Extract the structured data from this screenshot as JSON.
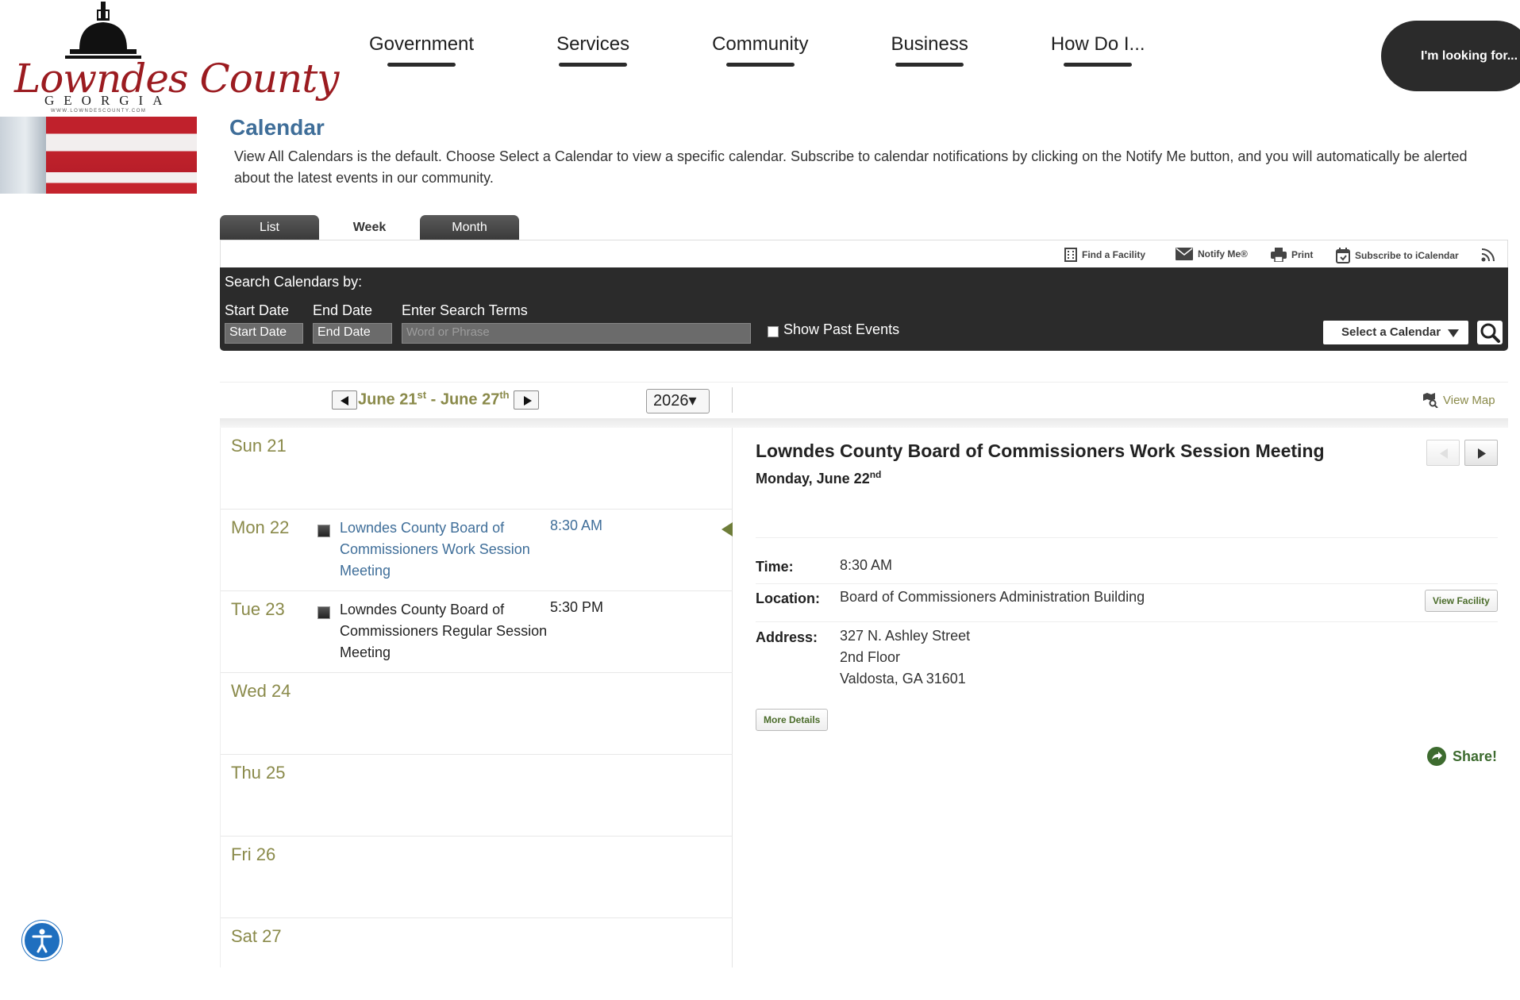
{
  "logo": {
    "script": "Lowndes County",
    "state": "GEORGIA",
    "url": "WWW.LOWNDESCOUNTY.COM"
  },
  "nav": [
    "Government",
    "Services",
    "Community",
    "Business",
    "How Do I..."
  ],
  "looking_for": "I'm looking for...",
  "page": {
    "title": "Calendar",
    "intro": "View All Calendars is the default. Choose Select a Calendar to view a specific calendar. Subscribe to calendar notifications by clicking on the Notify Me button, and you will automatically be alerted about the latest events in our community."
  },
  "tabs": [
    "List",
    "Week",
    "Month"
  ],
  "toolbar": {
    "find_facility": "Find a Facility",
    "notify": "Notify Me®",
    "print": "Print",
    "subscribe": "Subscribe to iCalendar"
  },
  "search": {
    "heading": "Search Calendars by:",
    "start_label": "Start Date",
    "end_label": "End Date",
    "terms_label": "Enter Search Terms",
    "start_value": "Start Date",
    "end_value": "End Date",
    "terms_placeholder": "Word or Phrase",
    "past_events": "Show Past Events",
    "select_calendar": "Select a Calendar"
  },
  "week": {
    "start": "June 21",
    "start_sup": "st",
    "sep": " - ",
    "end": "June 27",
    "end_sup": "th",
    "year": "2026",
    "view_map": "View Map"
  },
  "days": [
    {
      "name": "Sun 21"
    },
    {
      "name": "Mon 22",
      "event": "Lowndes County Board of Commissioners Work Session Meeting",
      "time": "8:30 AM"
    },
    {
      "name": "Tue 23",
      "event": "Lowndes County Board of Commissioners Regular Session Meeting",
      "time": "5:30 PM"
    },
    {
      "name": "Wed 24"
    },
    {
      "name": "Thu 25"
    },
    {
      "name": "Fri 26"
    },
    {
      "name": "Sat 27"
    }
  ],
  "detail": {
    "title": "Lowndes County Board of Commissioners Work Session Meeting",
    "date": "Monday, June 22",
    "date_sup": "nd",
    "time_label": "Time:",
    "time": "8:30 AM",
    "location_label": "Location:",
    "location": "Board of Commissioners Administration Building",
    "view_facility": "View Facility",
    "address_label": "Address:",
    "address_line1": "327 N. Ashley Street",
    "address_line2": "2nd Floor",
    "address_line3": "Valdosta, GA 31601",
    "more_details": "More Details",
    "share": "Share!"
  },
  "colors": {
    "accent_blue": "#3f6e99",
    "olive": "#8a8a4a",
    "dark_bar": "#2b2b2b",
    "share_green": "#3d6b2f"
  }
}
